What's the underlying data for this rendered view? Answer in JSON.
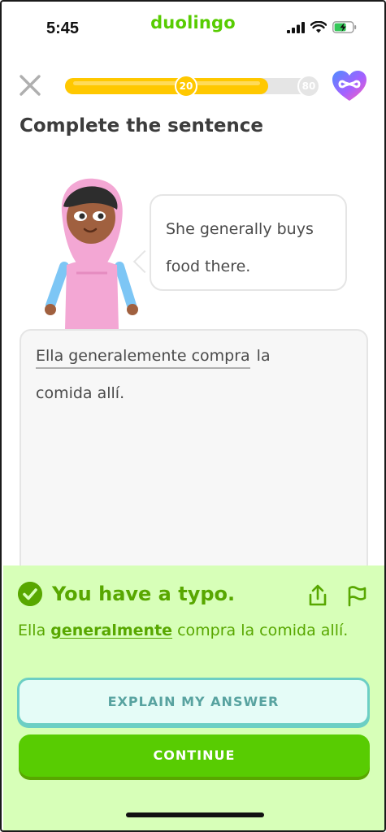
{
  "status_bar": {
    "time": "5:45",
    "brand": "duolingo",
    "icons": [
      "cellular-signal-icon",
      "wifi-icon",
      "battery-charging-icon"
    ]
  },
  "top_bar": {
    "close_icon": "close-icon",
    "progress": {
      "current_label": "20",
      "end_label": "80",
      "fill_fraction": 0.8
    },
    "hearts_icon": "infinite-hearts-icon"
  },
  "prompt": {
    "title": "Complete the sentence",
    "speech": {
      "line1": "She generally buys",
      "line2": "food there."
    }
  },
  "answer": {
    "typed": "Ella generalemente compra",
    "after": "la",
    "line2": "comida allí."
  },
  "feedback": {
    "title": "You have a typo.",
    "body_prefix": "Ella ",
    "corrected_word": "generalmente",
    "body_suffix": " compra la comida allí.",
    "explain_label": "EXPLAIN MY ANSWER",
    "continue_label": "CONTINUE"
  },
  "colors": {
    "brand_green": "#58cc02",
    "feedback_bg": "#d7ffb8",
    "feedback_text": "#58a700",
    "progress_yellow": "#ffc800",
    "explain_border": "#6ccfc4"
  }
}
